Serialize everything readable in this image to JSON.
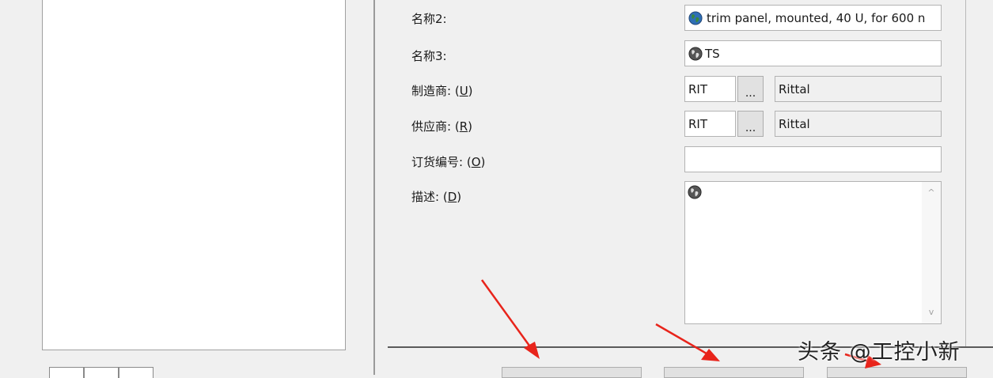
{
  "form": {
    "name2": {
      "label": "名称2:",
      "value": "trim panel, mounted, 40 U, for 600 n"
    },
    "name3": {
      "label": "名称3:",
      "value": "TS"
    },
    "manufacturer": {
      "label_text": "制造商: (",
      "mnemonic": "U",
      "label_end": ")",
      "code": "RIT",
      "browse_label": "...",
      "name": "Rittal"
    },
    "supplier": {
      "label_text": "供应商: (",
      "mnemonic": "R",
      "label_end": ")",
      "code": "RIT",
      "browse_label": "...",
      "name": "Rittal"
    },
    "order_number": {
      "label_text": "订货编号: (",
      "mnemonic": "O",
      "label_end": ")",
      "value": ""
    },
    "description": {
      "label_text": "描述: (",
      "mnemonic": "D",
      "label_end": ")",
      "value": ""
    },
    "scroll_up": "^",
    "scroll_down": "v"
  },
  "watermark": "头条 @工控小新",
  "colors": {
    "arrow": "#e8241b",
    "globe_blue": "#2f6fb5",
    "globe_green": "#3a8a3a",
    "globe_gray": "#555555"
  }
}
